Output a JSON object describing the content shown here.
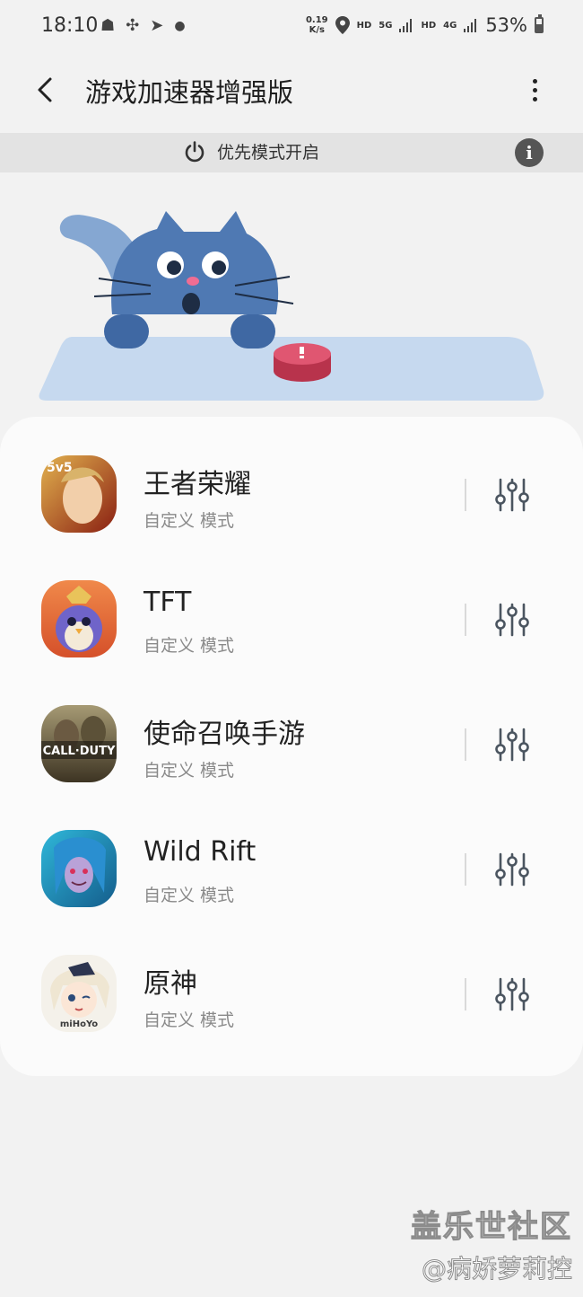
{
  "status_bar": {
    "time": "18:10",
    "left_icons": [
      "notification-app-icon",
      "fan-app-icon",
      "send-app-icon",
      "more-dot-icon"
    ],
    "net_speed": "0.19",
    "net_speed_unit": "K/s",
    "hd_label_1": "HD",
    "signal_label_1": "5G",
    "hd_label_2": "HD",
    "signal_label_2": "4G",
    "battery_percent": "53%"
  },
  "app_bar": {
    "title": "游戏加速器增强版"
  },
  "priority_band": {
    "label": "优先模式开启",
    "info_glyph": "i"
  },
  "games": [
    {
      "name": "王者荣耀",
      "mode": "自定义 模式",
      "icon": "honor-of-kings-icon"
    },
    {
      "name": "TFT",
      "mode": "自定义 模式",
      "icon": "tft-icon"
    },
    {
      "name": "使命召唤手游",
      "mode": "自定义 模式",
      "icon": "call-of-duty-icon"
    },
    {
      "name": "Wild Rift",
      "mode": "自定义 模式",
      "icon": "wild-rift-icon"
    },
    {
      "name": "原神",
      "mode": "自定义 模式",
      "icon": "genshin-icon"
    }
  ],
  "game_icon_texts": {
    "honor_badge": "5v5",
    "cod_logo": "CALL·DUTY",
    "genshin_logo": "miHoYo"
  },
  "watermark": {
    "line1": "盖乐世社区",
    "line2": "@病娇萝莉控"
  },
  "colors": {
    "background": "#f2f2f2",
    "card": "#fbfbfb",
    "band": "#e3e3e3",
    "cat": "#4f79b3",
    "mat": "#c6d9ef",
    "button_red": "#d2475f",
    "slider_icon": "#4b5560"
  }
}
